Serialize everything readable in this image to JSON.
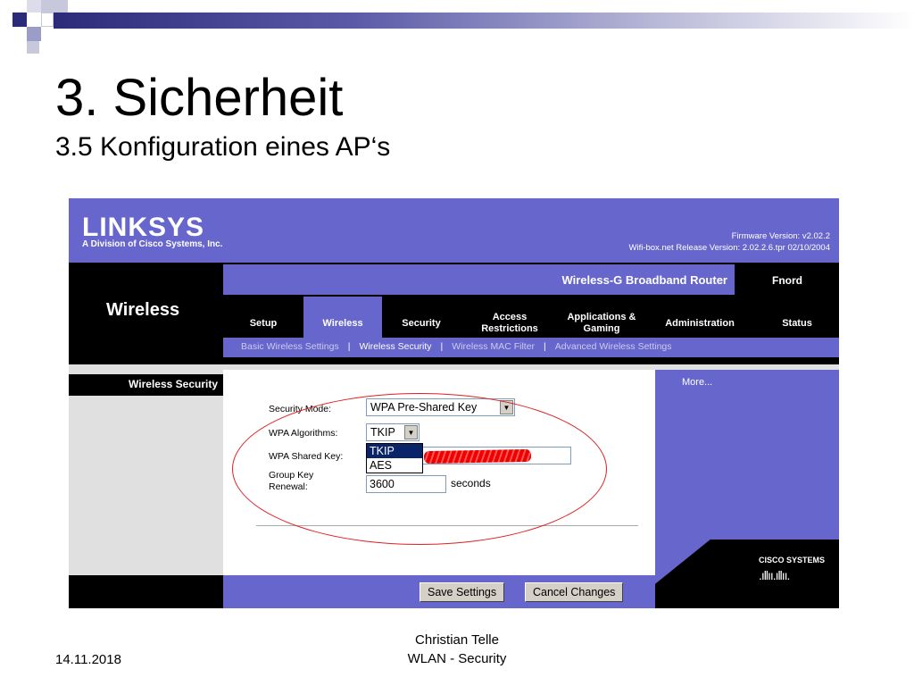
{
  "slide": {
    "title": "3. Sicherheit",
    "subtitle": "3.5  Konfiguration eines AP‘s",
    "footer_date": "14.11.2018",
    "footer_author": "Christian Telle",
    "footer_topic": "WLAN - Security"
  },
  "router": {
    "logo": "LINKSYS",
    "logo_sub": "A Division of Cisco Systems, Inc.",
    "firmware": "Firmware Version: v2.02.2",
    "release": "Wifi-box.net Release Version: 2.02.2.6.tpr 02/10/2004",
    "product": "Wireless-G Broadband Router",
    "model_name": "Fnord",
    "section": "Wireless",
    "tabs": [
      {
        "label": "Setup"
      },
      {
        "label": "Wireless"
      },
      {
        "label": "Security"
      },
      {
        "label": "Access Restrictions"
      },
      {
        "label": "Applications & Gaming"
      },
      {
        "label": "Administration"
      },
      {
        "label": "Status"
      }
    ],
    "subnav": [
      {
        "label": "Basic Wireless Settings"
      },
      {
        "label": "Wireless Security"
      },
      {
        "label": "Wireless MAC Filter"
      },
      {
        "label": "Advanced Wireless Settings"
      }
    ],
    "subnav_separator": "|",
    "left_label": "Wireless Security",
    "more": "More...",
    "form": {
      "security_mode_label": "Security Mode:",
      "security_mode_value": "WPA Pre-Shared Key",
      "wpa_algorithms_label": "WPA Algorithms:",
      "wpa_algorithms_value": "TKIP",
      "wpa_algorithms_options": [
        "TKIP",
        "AES"
      ],
      "shared_key_label": "WPA Shared Key:",
      "group_key_label_1": "Group Key",
      "group_key_label_2": "Renewal:",
      "group_key_value": "3600",
      "seconds": "seconds"
    },
    "save_button": "Save Settings",
    "cancel_button": "Cancel Changes",
    "cisco": "CISCO SYSTEMS",
    "colors": {
      "accent": "#6666cc",
      "highlight": "#e02020"
    }
  }
}
